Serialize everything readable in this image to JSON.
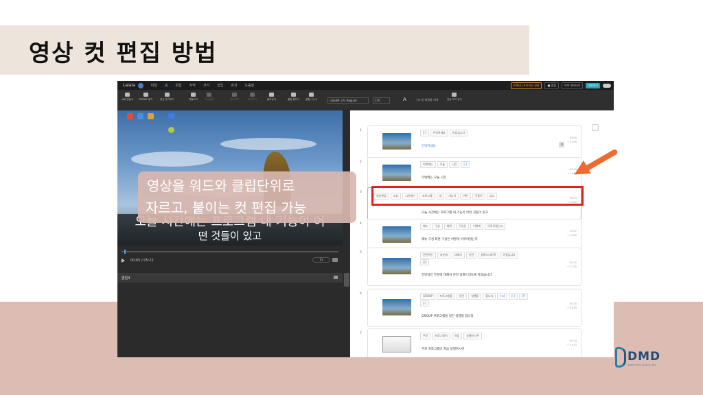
{
  "slide": {
    "title": "영상 컷 편집 방법",
    "overlay_line1": "영상을 워드와 클립단위로",
    "overlay_line2": "자르고, 붙이는 컷 편집 가능"
  },
  "colors": {
    "title_band": "#ede4dc",
    "bottom_band": "#dcbcb3",
    "highlight_box": "#e0211c",
    "arrow": "#ee6a2e",
    "accent": "#26a6b4"
  },
  "app": {
    "brand": "Lalala",
    "menu": [
      "파일",
      "홈",
      "편집",
      "자막",
      "서식",
      "삽입",
      "효과",
      "도움말"
    ],
    "active_menu": "홈",
    "right_actions": {
      "promo": "[FREE] 프리미엄 전환",
      "help": "■ 알림",
      "export": "자막 내보내기",
      "share": "내보내기"
    },
    "toolbar": {
      "tools": [
        "새로 만들기",
        "프로젝트 열기",
        "영상 추가하기",
        "되돌리기",
        "다시실행",
        "잘라내기",
        "복사하기",
        "붙여넣기",
        "클립 합치기",
        "클립 나누기",
        "영상 자막 넣기"
      ],
      "font": "나눔바른 고딕 Regular",
      "font_size": "150",
      "style_label": "[서식] 배경을 여백"
    },
    "video": {
      "subtitle_line1": "오늘 시간에는 프로그램 내 기능이 어",
      "subtitle_line2": "떤 것들이 있고",
      "time": "00:05 / 05:22",
      "speed": "1x",
      "panel_title": "클립3"
    },
    "clips": [
      {
        "num": "1",
        "words": [
          "[-]",
          "안녕하세요",
          "반갑습니다"
        ],
        "sentence": "안녕하세요",
        "meta1": "00:00",
        "meta2": "+ 2.400",
        "tag": "가"
      },
      {
        "num": "2",
        "words": [
          "이번에는",
          "오늘",
          "시간",
          "[-]"
        ],
        "sentence": "이번에는 오늘 시간",
        "meta1": "00:03",
        "meta2": "+ 1.800"
      },
      {
        "num": "3",
        "words": [
          "영상편집",
          "오늘",
          "시간에는",
          "프로그램",
          "내",
          "기능이",
          "어떤",
          "것들이",
          "있고"
        ],
        "sentence": "오늘 시간에는 프로그램 내 기능이 어떤 것들이 있고",
        "meta1": "00:04",
        "meta2": "+ 2.400"
      },
      {
        "num": "4",
        "words": [
          "메뉴",
          "구성",
          "화면",
          "구성은",
          "어떻게",
          "이루어졌는지"
        ],
        "sentence": "메뉴 구성 화면 구성은 어떻게 이루어졌는지",
        "meta1": "00:07",
        "meta2": "+ 2.600"
      },
      {
        "num": "5",
        "words": [
          "전반적인",
          "부분에",
          "대해서",
          "한번",
          "살펴드리도록",
          "하겠습니다",
          "[?]"
        ],
        "sentence": "전반적인 부분에 대해서 한번 살펴드리도록 하겠습니다",
        "meta1": "00:10",
        "meta2": "+ 3.700"
      },
      {
        "num": "6",
        "words": [
          "GROUP",
          "프로그램을",
          "일단",
          "실행을",
          "합니다",
          "[-o]",
          "[-]",
          "[?]",
          "[-]"
        ],
        "sentence": "GROUP 프로그램을 일단 실행을 합니다",
        "meta1": "00:15",
        "meta2": "+ 8.070"
      },
      {
        "num": "7",
        "words": [
          "주로",
          "프로그램이",
          "처음",
          "실행하시면"
        ],
        "sentence": "주로 프로그램이 처음 실행하시면",
        "meta1": "00:24",
        "meta2": "+ 3.410"
      }
    ]
  },
  "logo": {
    "text": "DMD",
    "tagline": "digital media design & data"
  }
}
